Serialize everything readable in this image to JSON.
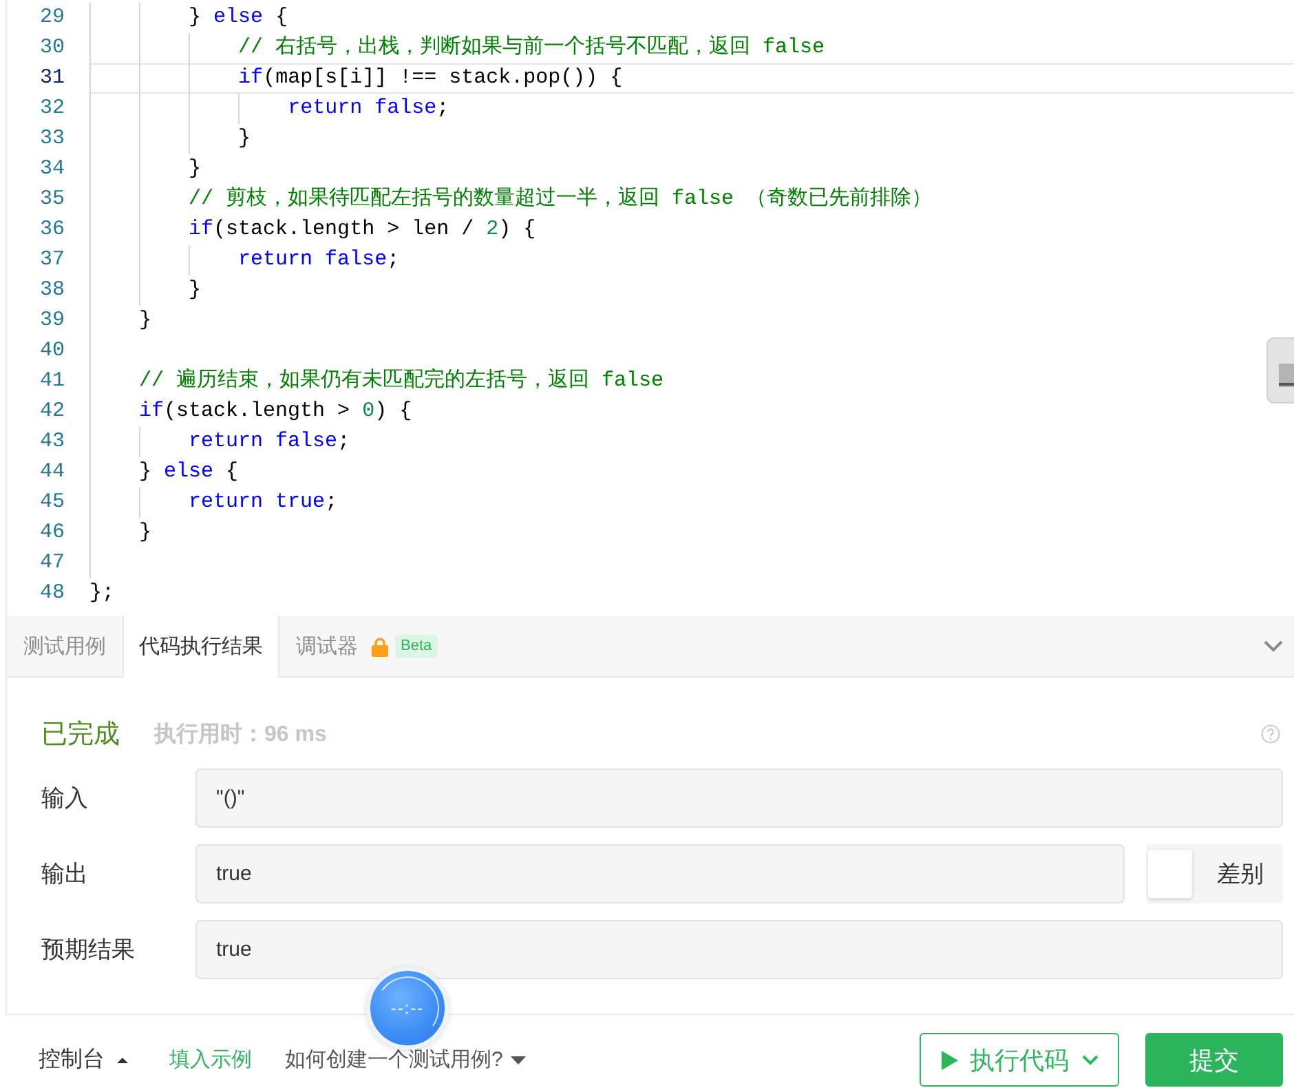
{
  "editor": {
    "lines": [
      {
        "number": "29",
        "current": false,
        "code": [
          {
            "kind": "plain",
            "text": "        } "
          },
          {
            "kind": "keyword",
            "text": "else"
          },
          {
            "kind": "plain",
            "text": " {"
          }
        ]
      },
      {
        "number": "30",
        "current": false,
        "code": [
          {
            "kind": "comment",
            "text": "            // 右括号，出栈，判断如果与前一个括号不匹配，返回 false"
          }
        ]
      },
      {
        "number": "31",
        "current": true,
        "code": [
          {
            "kind": "keyword",
            "text": "            if"
          },
          {
            "kind": "plain",
            "text": "(map[s[i]] !== stack.pop()) {"
          }
        ]
      },
      {
        "number": "32",
        "current": false,
        "code": [
          {
            "kind": "keyword",
            "text": "                return false"
          },
          {
            "kind": "plain",
            "text": ";"
          }
        ]
      },
      {
        "number": "33",
        "current": false,
        "code": [
          {
            "kind": "plain",
            "text": "            }"
          }
        ]
      },
      {
        "number": "34",
        "current": false,
        "code": [
          {
            "kind": "plain",
            "text": "        }"
          }
        ]
      },
      {
        "number": "35",
        "current": false,
        "code": [
          {
            "kind": "comment",
            "text": "        // 剪枝，如果待匹配左括号的数量超过一半，返回 false （奇数已先前排除）"
          }
        ]
      },
      {
        "number": "36",
        "current": false,
        "code": [
          {
            "kind": "keyword",
            "text": "        if"
          },
          {
            "kind": "plain",
            "text": "(stack.length > len / "
          },
          {
            "kind": "number",
            "text": "2"
          },
          {
            "kind": "plain",
            "text": ") {"
          }
        ]
      },
      {
        "number": "37",
        "current": false,
        "code": [
          {
            "kind": "keyword",
            "text": "            return false"
          },
          {
            "kind": "plain",
            "text": ";"
          }
        ]
      },
      {
        "number": "38",
        "current": false,
        "code": [
          {
            "kind": "plain",
            "text": "        }"
          }
        ]
      },
      {
        "number": "39",
        "current": false,
        "code": [
          {
            "kind": "plain",
            "text": "    }"
          }
        ]
      },
      {
        "number": "40",
        "current": false
      },
      {
        "number": "41",
        "current": false,
        "code": [
          {
            "kind": "comment",
            "text": "    // 遍历结束，如果仍有未匹配完的左括号，返回 false"
          }
        ]
      },
      {
        "number": "42",
        "current": false,
        "code": [
          {
            "kind": "keyword",
            "text": "    if"
          },
          {
            "kind": "plain",
            "text": "(stack.length > "
          },
          {
            "kind": "number",
            "text": "0"
          },
          {
            "kind": "plain",
            "text": ") {"
          }
        ]
      },
      {
        "number": "43",
        "current": false,
        "code": [
          {
            "kind": "keyword",
            "text": "        return false"
          },
          {
            "kind": "plain",
            "text": ";"
          }
        ]
      },
      {
        "number": "44",
        "current": false,
        "code": [
          {
            "kind": "plain",
            "text": "    } "
          },
          {
            "kind": "keyword",
            "text": "else"
          },
          {
            "kind": "plain",
            "text": " {"
          }
        ]
      },
      {
        "number": "45",
        "current": false,
        "code": [
          {
            "kind": "keyword",
            "text": "        return true"
          },
          {
            "kind": "plain",
            "text": ";"
          }
        ]
      },
      {
        "number": "46",
        "current": false,
        "code": [
          {
            "kind": "plain",
            "text": "    }"
          }
        ]
      },
      {
        "number": "47",
        "current": false
      },
      {
        "number": "48",
        "current": false,
        "code": [
          {
            "kind": "plain",
            "text": "};"
          }
        ]
      }
    ]
  },
  "console_tabs": [
    {
      "label": "测试用例",
      "selected": false,
      "locked": false
    },
    {
      "label": "代码执行结果",
      "selected": true,
      "locked": false
    },
    {
      "label": "调试器",
      "selected": false,
      "locked": true,
      "badge": "Beta"
    }
  ],
  "result": {
    "status": "已完成",
    "runtime": "执行用时：96 ms",
    "fields": [
      {
        "label": "输入",
        "value": "\"()\""
      },
      {
        "label": "输出",
        "value": "true",
        "diff_toggle": {
          "label": "差别",
          "on": false
        }
      },
      {
        "label": "预期结果",
        "value": "true"
      }
    ]
  },
  "bottom_bar": {
    "console_button": "控制台",
    "fill_example_link": "填入示例",
    "help_menu": "如何创建一个测试用例?",
    "run_button": "执行代码",
    "submit_button": "提交"
  },
  "timer": {
    "display": "--:--"
  }
}
